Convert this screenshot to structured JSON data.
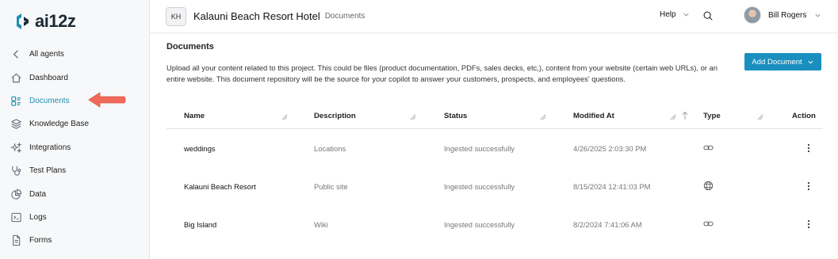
{
  "brand": {
    "name": "ai12z",
    "accent": "#1a8fbf"
  },
  "sidebar": {
    "items": [
      {
        "label": "All agents",
        "icon": "chevron-left-icon"
      },
      {
        "label": "Dashboard",
        "icon": "home-icon"
      },
      {
        "label": "Documents",
        "icon": "documents-icon",
        "active": true
      },
      {
        "label": "Knowledge Base",
        "icon": "layers-icon"
      },
      {
        "label": "Integrations",
        "icon": "sparkles-icon"
      },
      {
        "label": "Test Plans",
        "icon": "stethoscope-icon"
      },
      {
        "label": "Data",
        "icon": "pie-chart-icon"
      },
      {
        "label": "Logs",
        "icon": "terminal-icon"
      },
      {
        "label": "Forms",
        "icon": "file-icon"
      }
    ]
  },
  "header": {
    "project_initials": "KH",
    "project_name": "Kalauni Beach Resort Hotel",
    "breadcrumb": "Documents",
    "help_label": "Help",
    "user_name": "Bill Rogers"
  },
  "main": {
    "title": "Documents",
    "description": "Upload all your content related to this project. This could be files (product documentation, PDFs, sales decks, etc,), content from your website (certain web URLs), or an entire website. This document repository will be the source for your copilot to answer your customers, prospects, and employees' questions.",
    "add_button_label": "Add Document"
  },
  "table": {
    "columns": [
      "Name",
      "Description",
      "Status",
      "Modified At",
      "Type",
      "Action"
    ],
    "rows": [
      {
        "name": "weddings",
        "description": "Locations",
        "status": "Ingested successfully",
        "modified": "4/26/2025 2:03:30 PM",
        "type": "link-icon"
      },
      {
        "name": "Kalauni Beach Resort",
        "description": "Public site",
        "status": "Ingested successfully",
        "modified": "8/15/2024 12:41:03 PM",
        "type": "globe-icon"
      },
      {
        "name": "Big Island",
        "description": "Wiki",
        "status": "Ingested successfully",
        "modified": "8/2/2024 7:41:06 AM",
        "type": "link-icon"
      }
    ]
  }
}
